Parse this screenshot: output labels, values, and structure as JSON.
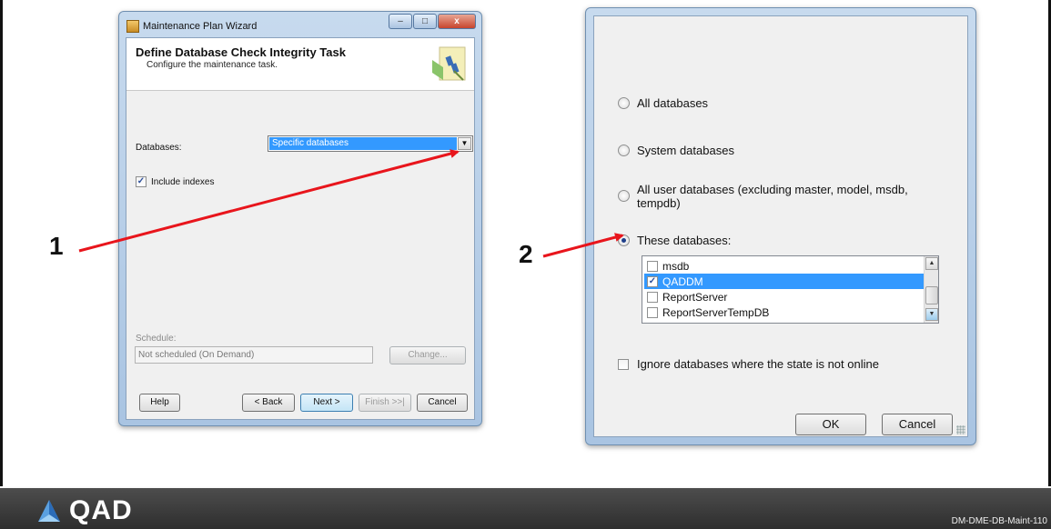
{
  "wizard": {
    "title": "Maintenance Plan Wizard",
    "heading": "Define Database Check Integrity Task",
    "subheading": "Configure the maintenance task.",
    "databases_label": "Databases:",
    "databases_value": "Specific databases",
    "include_indexes_label": "Include indexes",
    "include_indexes_checked": true,
    "schedule_label": "Schedule:",
    "schedule_value": "Not scheduled (On Demand)",
    "change_label": "Change...",
    "help_label": "Help",
    "back_label": "< Back",
    "next_label": "Next >",
    "finish_label": "Finish >>|",
    "cancel_label": "Cancel",
    "window_buttons": [
      "–",
      "□",
      "x"
    ]
  },
  "dialog": {
    "options": [
      {
        "label": "All databases",
        "selected": false
      },
      {
        "label": "System databases",
        "selected": false
      },
      {
        "label": "All user databases  (excluding master, model, msdb, tempdb)",
        "selected": false
      },
      {
        "label": "These databases:",
        "selected": true
      }
    ],
    "databases": [
      {
        "name": "msdb",
        "checked": false,
        "selected": false
      },
      {
        "name": "QADDM",
        "checked": true,
        "selected": true
      },
      {
        "name": "ReportServer",
        "checked": false,
        "selected": false
      },
      {
        "name": "ReportServerTempDB",
        "checked": false,
        "selected": false
      }
    ],
    "ignore_label": "Ignore databases where the state is not online",
    "ok_label": "OK",
    "cancel_label": "Cancel"
  },
  "annotations": {
    "step1": "1",
    "step2": "2",
    "arrow_color": "#e8151c"
  },
  "footer": {
    "logo_text": "QAD",
    "slide_code": "DM-DME-DB-Maint-110"
  }
}
